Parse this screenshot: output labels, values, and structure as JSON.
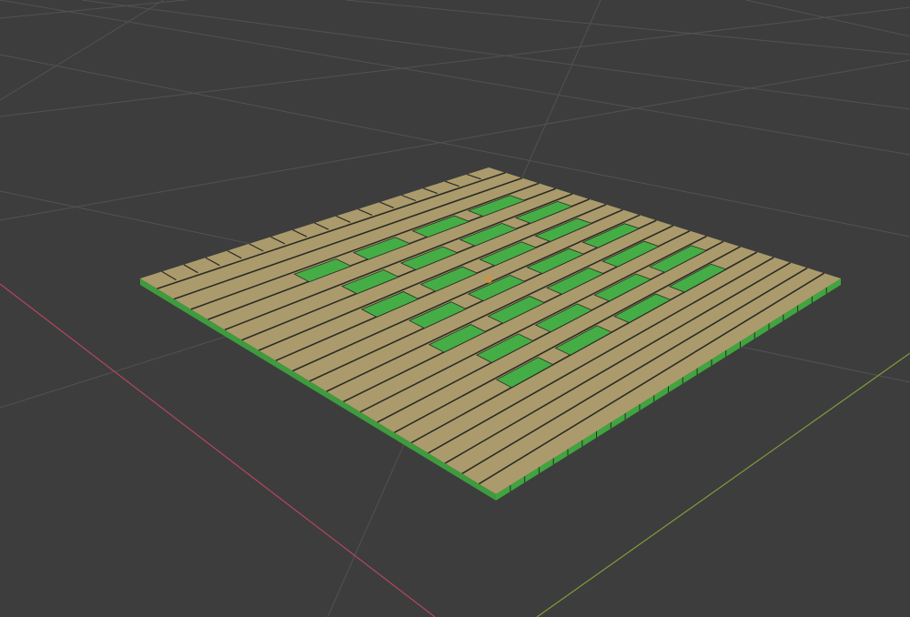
{
  "viewport": {
    "background_color": "#3d3d3d",
    "grid_color": "#525252",
    "x_axis_color": "#b4465f",
    "y_axis_color": "#7c9c3a",
    "origin_color": "#e0902c"
  },
  "mat": {
    "base_color": "#a9996a",
    "base_top_color": "#ab9b6c",
    "plank_gap_color": "#2c2c26",
    "edge_color": "#3e9b3e",
    "highlight_color": "#3fa53f",
    "highlight_top_color": "#45ad45",
    "plank_count": 21,
    "icon": "woven-mat-object"
  },
  "origin": {
    "icon": "object-origin-dot"
  }
}
